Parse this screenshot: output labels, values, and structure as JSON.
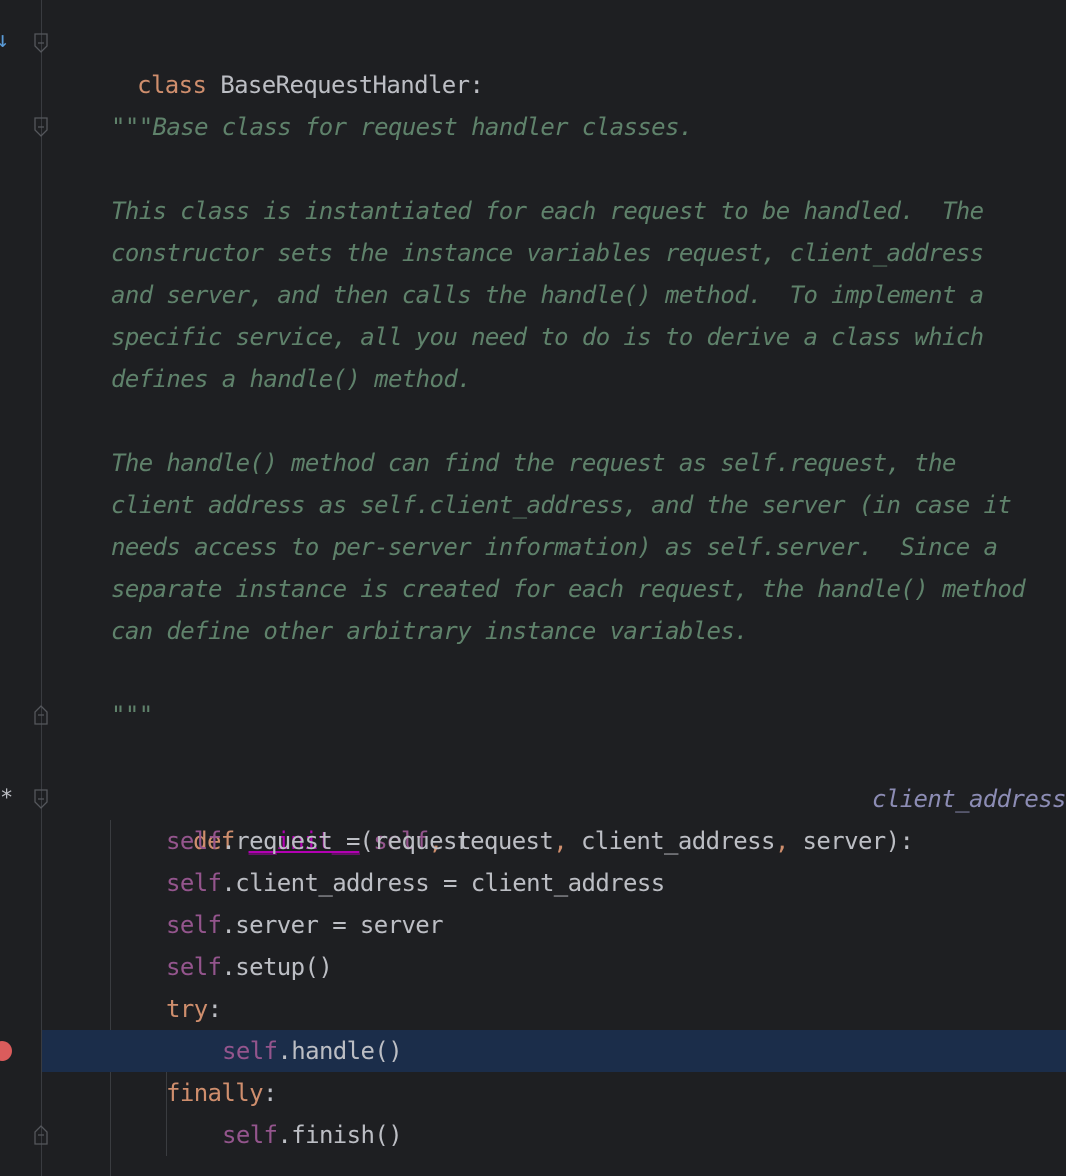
{
  "editor": {
    "class_keyword": "class",
    "class_name": "BaseRequestHandler",
    "colon": ":",
    "doc_lines": [
      "\"\"\"Base class for request handler classes.",
      "",
      "This class is instantiated for each request to be handled.  The",
      "constructor sets the instance variables request, client_address",
      "and server, and then calls the handle() method.  To implement a",
      "specific service, all you need to do is to derive a class which",
      "defines a handle() method.",
      "",
      "The handle() method can find the request as self.request, the",
      "client address as self.client_address, and the server (in case it",
      "needs access to per-server information) as self.server.  Since a",
      "separate instance is created for each request, the handle() method",
      "can define other arbitrary instance variables.",
      "",
      "\"\"\""
    ],
    "def_keyword": "def",
    "init_name": "__init__",
    "init_params_open": "(",
    "param_self": "self",
    "comma1": ", ",
    "param_request": "request",
    "comma2": ", ",
    "param_client_address": "client_address",
    "comma3": ", ",
    "param_server": "server",
    "init_params_close": "):",
    "inline_hint": "client_address",
    "body": {
      "l1_self": "self",
      "l1_rest": ".request = request",
      "l2_self": "self",
      "l2_rest": ".client_address = client_address",
      "l3_self": "self",
      "l3_rest": ".server = server",
      "l4_self": "self",
      "l4_rest": ".setup()",
      "try_kw": "try",
      "try_colon": ":",
      "l6_self": "self",
      "l6_rest": ".handle()",
      "finally_kw": "finally",
      "finally_colon": ":",
      "l8_self": "self",
      "l8_rest": ".finish()"
    },
    "gutter": {
      "override_marker": "↓",
      "star_marker": "*"
    },
    "colors": {
      "background": "#1e1f22",
      "keyword": "#cf8e6d",
      "self": "#94558d",
      "docstring": "#5f826b",
      "breakpoint": "#db5c5c",
      "current_line": "#1b2d4a"
    }
  }
}
